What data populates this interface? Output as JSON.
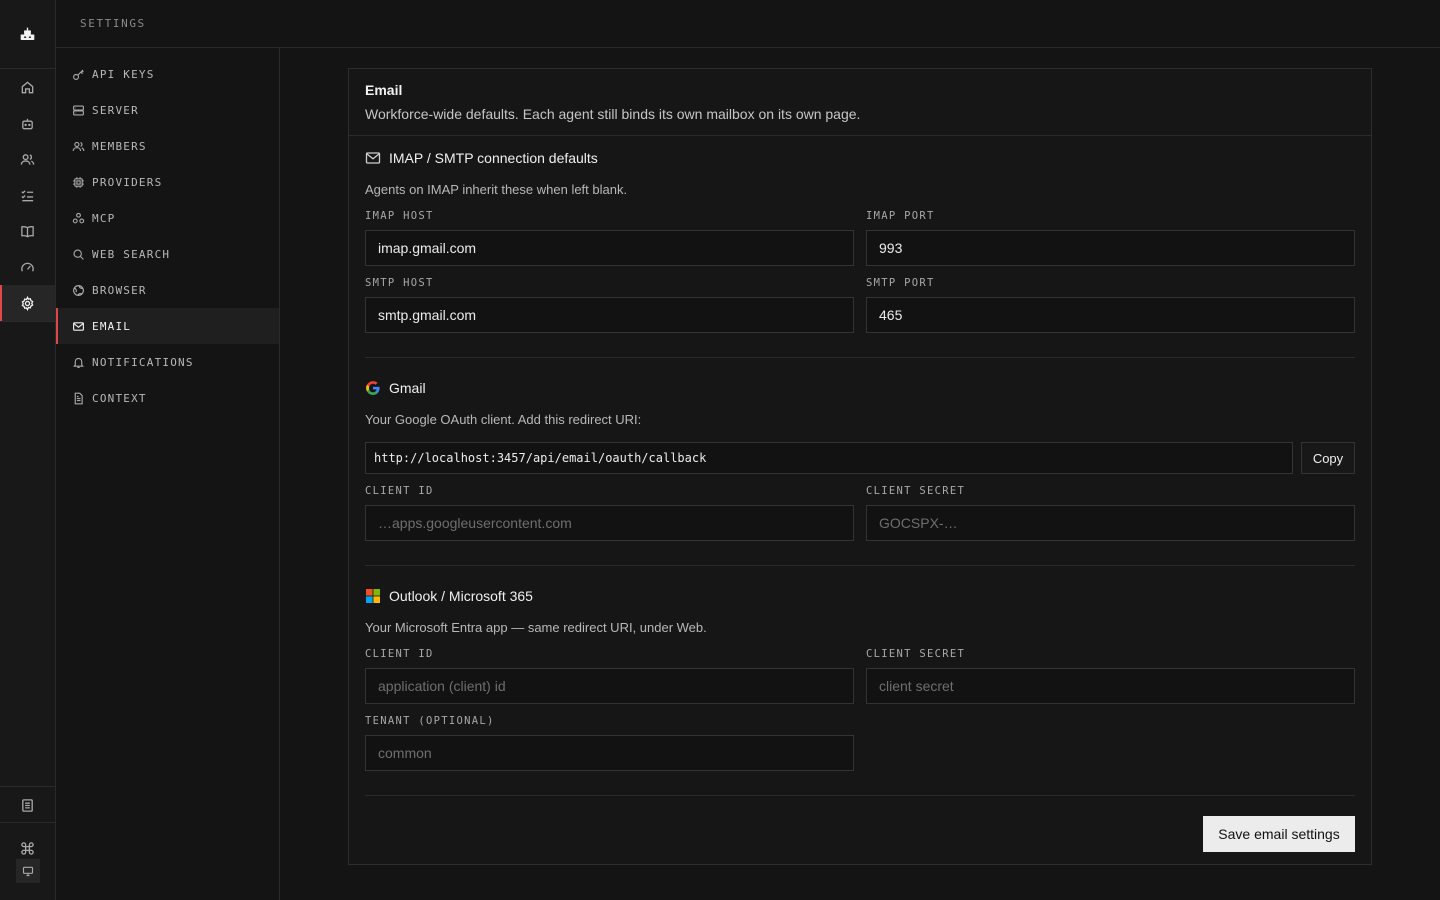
{
  "header": {
    "title": "SETTINGS"
  },
  "rail": {
    "items": [
      {
        "icon": "home-icon"
      },
      {
        "icon": "robot-icon"
      },
      {
        "icon": "users-icon"
      },
      {
        "icon": "checklist-icon"
      },
      {
        "icon": "book-icon"
      },
      {
        "icon": "gauge-icon"
      },
      {
        "icon": "gear-icon",
        "active": true
      }
    ],
    "bottom": [
      {
        "icon": "document-icon"
      },
      {
        "icon": "command-icon"
      },
      {
        "icon": "monitor-icon"
      }
    ]
  },
  "sidebar": {
    "items": [
      {
        "label": "API KEYS",
        "icon": "key-icon"
      },
      {
        "label": "SERVER",
        "icon": "server-icon"
      },
      {
        "label": "MEMBERS",
        "icon": "users-icon"
      },
      {
        "label": "PROVIDERS",
        "icon": "chip-icon"
      },
      {
        "label": "MCP",
        "icon": "nodes-icon"
      },
      {
        "label": "WEB SEARCH",
        "icon": "search-icon"
      },
      {
        "label": "BROWSER",
        "icon": "globe-icon"
      },
      {
        "label": "EMAIL",
        "icon": "mail-icon",
        "active": true
      },
      {
        "label": "NOTIFICATIONS",
        "icon": "bell-icon"
      },
      {
        "label": "CONTEXT",
        "icon": "file-icon"
      }
    ]
  },
  "card": {
    "title": "Email",
    "description": "Workforce-wide defaults. Each agent still binds its own mailbox on its own page."
  },
  "imap": {
    "title": "IMAP / SMTP connection defaults",
    "description": "Agents on IMAP inherit these when left blank.",
    "imap_host_label": "IMAP HOST",
    "imap_host_value": "imap.gmail.com",
    "imap_port_label": "IMAP PORT",
    "imap_port_value": "993",
    "smtp_host_label": "SMTP HOST",
    "smtp_host_value": "smtp.gmail.com",
    "smtp_port_label": "SMTP PORT",
    "smtp_port_value": "465"
  },
  "gmail": {
    "title": "Gmail",
    "description": "Your Google OAuth client. Add this redirect URI:",
    "redirect_uri": "http://localhost:3457/api/email/oauth/callback",
    "copy_label": "Copy",
    "client_id_label": "CLIENT ID",
    "client_id_placeholder": "…apps.googleusercontent.com",
    "client_secret_label": "CLIENT SECRET",
    "client_secret_placeholder": "GOCSPX-…"
  },
  "outlook": {
    "title": "Outlook / Microsoft 365",
    "description": "Your Microsoft Entra app — same redirect URI, under Web.",
    "client_id_label": "CLIENT ID",
    "client_id_placeholder": "application (client) id",
    "client_secret_label": "CLIENT SECRET",
    "client_secret_placeholder": "client secret",
    "tenant_label": "TENANT (OPTIONAL)",
    "tenant_placeholder": "common"
  },
  "actions": {
    "save_label": "Save email settings"
  },
  "colors": {
    "accent": "#e04848",
    "background": "#141414",
    "button": "#ececec"
  }
}
